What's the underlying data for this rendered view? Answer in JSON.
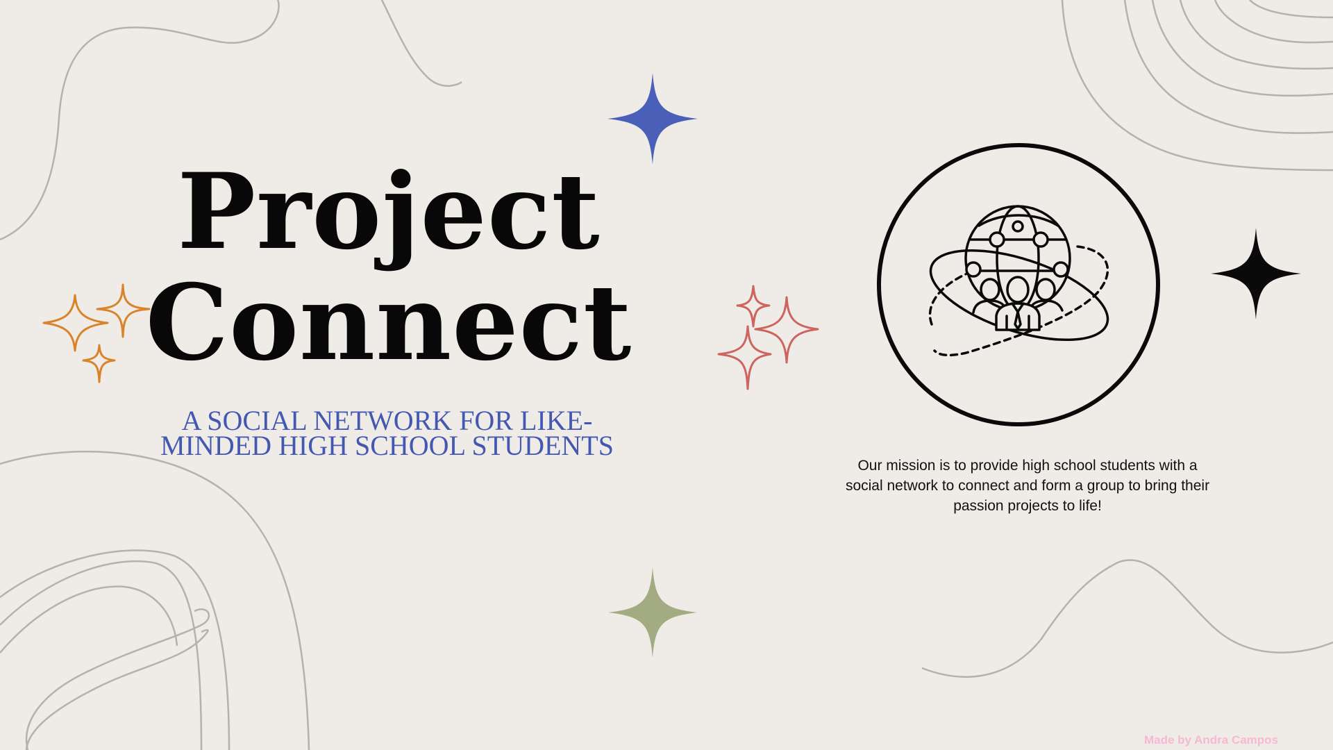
{
  "slide": {
    "title_line1": "Project",
    "title_line2": "Connect",
    "subtitle": "A social network for like-minded high school students",
    "mission": "Our mission is to provide high school students with a social network to connect and form a group to bring their passion projects to life!",
    "credit": "Made by Andra Campos"
  },
  "icons": {
    "emblem": "globe-network-people-icon",
    "sparkles": [
      "sparkle-blue-icon",
      "sparkle-black-icon",
      "sparkle-green-icon",
      "sparkles-orange-icon",
      "sparkles-red-icon"
    ]
  },
  "colors": {
    "background": "#efebe6",
    "title": "#080808",
    "subtitle": "#4458b2",
    "credit": "#f6b8d4",
    "sparkle_blue": "#4a5fb8",
    "sparkle_green": "#a3ab82",
    "sparkle_orange": "#d9832a",
    "sparkle_red": "#cc6460",
    "lines": "#b4b2ae"
  }
}
